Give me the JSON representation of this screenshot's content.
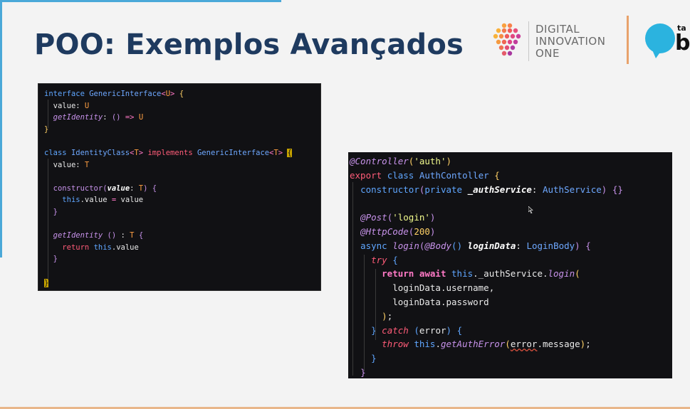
{
  "slide": {
    "title": "POO: Exemplos Avançados"
  },
  "branding": {
    "dio_lines": [
      "DIGITAL",
      "INNOVATION",
      "ONE"
    ],
    "partner_small": "ta",
    "partner_big": "b",
    "colors": {
      "title": "#1e3a5f",
      "accent_blue": "#4aa8d8",
      "accent_orange": "#e8a26b",
      "bubble": "#2bb3df"
    }
  },
  "code_left": {
    "lines": [
      "interface GenericInterface<U> {",
      "  value: U",
      "  getIdentity: () => U",
      "}",
      "",
      "class IdentityClass<T> implements GenericInterface<T> {",
      "  value: T",
      "",
      "  constructor(value: T) {",
      "    this.value = value",
      "  }",
      "",
      "  getIdentity () : T {",
      "    return this.value",
      "  }",
      "",
      "}"
    ]
  },
  "code_right": {
    "lines": [
      "@Controller('auth')",
      "export class AuthContoller {",
      "  constructor(private _authService: AuthService) {}",
      "",
      "  @Post('login')",
      "  @HttpCode(200)",
      "  async login(@Body() loginData: LoginBody) {",
      "    try {",
      "      return await this._authService.login(",
      "        loginData.username,",
      "        loginData.password",
      "      );",
      "    } catch (error) {",
      "      throw this.getAuthError(error.message);",
      "    }",
      "  }"
    ]
  }
}
